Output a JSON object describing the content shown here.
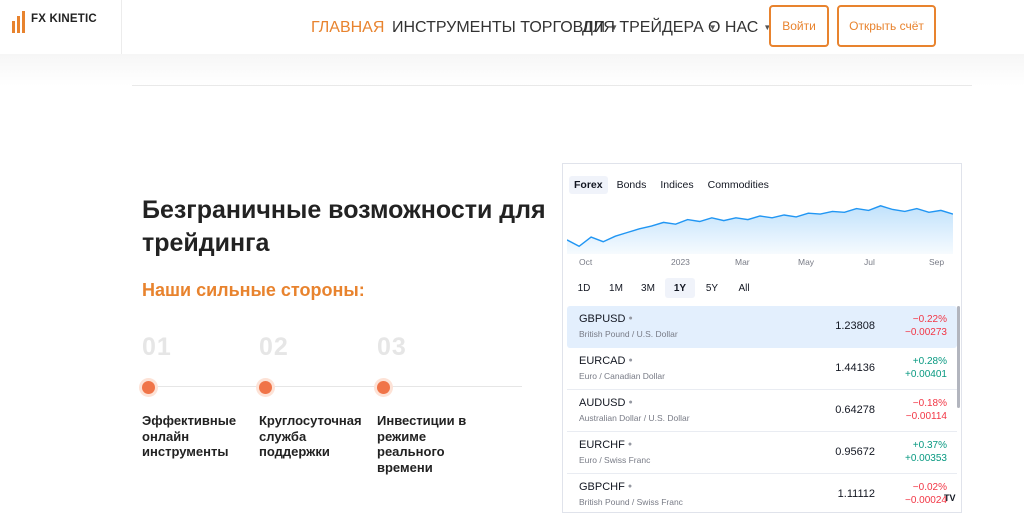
{
  "brand": {
    "name": "FX KINETIC",
    "accent": "#e8832e"
  },
  "nav": {
    "items": [
      {
        "label": "ГЛАВНАЯ",
        "active": true,
        "dropdown": false
      },
      {
        "label": "ИНСТРУМЕНТЫ ТОРГОВЛИ",
        "active": false,
        "dropdown": true
      },
      {
        "label": "ДЛЯ ТРЕЙДЕРА",
        "active": false,
        "dropdown": true
      },
      {
        "label": "О НАС",
        "active": false,
        "dropdown": true
      }
    ],
    "login_label": "Войти",
    "open_account_label": "Открыть счёт"
  },
  "hero": {
    "title": "Безграничные возможности для трейдинга",
    "subtitle": "Наши сильные стороны:",
    "features": [
      {
        "num": "01",
        "text": "Эффективные онлайн инструменты"
      },
      {
        "num": "02",
        "text": "Круглосуточная служба поддержки"
      },
      {
        "num": "03",
        "text": "Инвестиции в режиме реального времени"
      }
    ]
  },
  "widget": {
    "tabs": [
      {
        "label": "Forex",
        "active": true
      },
      {
        "label": "Bonds",
        "active": false
      },
      {
        "label": "Indices",
        "active": false
      },
      {
        "label": "Commodities",
        "active": false
      }
    ],
    "axis_labels": [
      "Oct",
      "2023",
      "Mar",
      "May",
      "Jul",
      "Sep"
    ],
    "ranges": [
      {
        "label": "1D",
        "active": false
      },
      {
        "label": "1M",
        "active": false
      },
      {
        "label": "3M",
        "active": false
      },
      {
        "label": "1Y",
        "active": true
      },
      {
        "label": "5Y",
        "active": false
      },
      {
        "label": "All",
        "active": false
      }
    ],
    "line_color": "#2196f3",
    "series_trend": [
      0.22,
      0.08,
      0.28,
      0.18,
      0.3,
      0.38,
      0.46,
      0.52,
      0.6,
      0.56,
      0.66,
      0.62,
      0.7,
      0.64,
      0.7,
      0.66,
      0.74,
      0.7,
      0.76,
      0.72,
      0.8,
      0.78,
      0.84,
      0.82,
      0.9,
      0.86,
      0.96,
      0.88,
      0.84,
      0.9,
      0.82,
      0.86,
      0.78
    ],
    "rows": [
      {
        "symbol": "GBPUSD",
        "desc": "British Pound / U.S. Dollar",
        "price": "1.23808",
        "pct": "−0.22%",
        "chg": "−0.00273",
        "dir": "neg",
        "selected": true
      },
      {
        "symbol": "EURCAD",
        "desc": "Euro / Canadian Dollar",
        "price": "1.44136",
        "pct": "+0.28%",
        "chg": "+0.00401",
        "dir": "pos",
        "selected": false
      },
      {
        "symbol": "AUDUSD",
        "desc": "Australian Dollar / U.S. Dollar",
        "price": "0.64278",
        "pct": "−0.18%",
        "chg": "−0.00114",
        "dir": "neg",
        "selected": false
      },
      {
        "symbol": "EURCHF",
        "desc": "Euro / Swiss Franc",
        "price": "0.95672",
        "pct": "+0.37%",
        "chg": "+0.00353",
        "dir": "pos",
        "selected": false
      },
      {
        "symbol": "GBPCHF",
        "desc": "British Pound / Swiss Franc",
        "price": "1.11112",
        "pct": "−0.02%",
        "chg": "−0.00024",
        "dir": "neg",
        "selected": false
      }
    ],
    "badge": "TV"
  }
}
